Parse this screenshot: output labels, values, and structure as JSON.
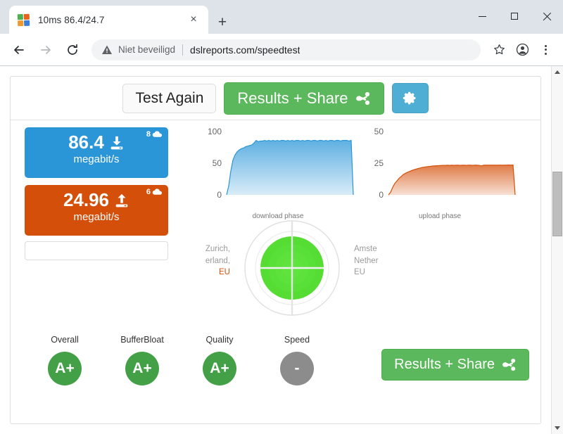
{
  "window": {
    "minimize_label": "Minimize",
    "maximize_label": "Maximize",
    "close_label": "Close"
  },
  "tab": {
    "title": "10ms 86.4/24.7",
    "close_label": "×",
    "newtab_label": "+"
  },
  "toolbar": {
    "back_label": "←",
    "forward_label": "→",
    "reload_label": "⟳",
    "security_text": "Niet beveiligd",
    "url": "dslreports.com/speedtest",
    "bookmark_label": "☆",
    "profile_label": "profile",
    "menu_label": "menu"
  },
  "page": {
    "top_buttons": {
      "test_again": "Test Again",
      "results_share": "Results + Share",
      "settings": "gear"
    },
    "download": {
      "value": "86.4",
      "unit": "megabit/s",
      "streams": "8"
    },
    "upload": {
      "value": "24.96",
      "unit": "megabit/s",
      "streams": "6"
    },
    "input_field": {
      "value": "",
      "placeholder": ""
    },
    "radar": {
      "left_label_line1": "Zurich,",
      "left_label_line2": "erland,",
      "left_label_line3": "EU",
      "right_label_line1": "Amste",
      "right_label_line2": "Nether",
      "right_label_line3": "EU"
    },
    "grades": [
      {
        "label": "Overall",
        "value": "A+",
        "color": "green"
      },
      {
        "label": "BufferBloat",
        "value": "A+",
        "color": "green"
      },
      {
        "label": "Quality",
        "value": "A+",
        "color": "green"
      },
      {
        "label": "Speed",
        "value": "-",
        "color": "gray"
      }
    ],
    "results_share_large": "Results + Share"
  },
  "colors": {
    "download_blue": "#2a96d8",
    "upload_orange": "#d4500a",
    "green_button": "#5cb85c",
    "gear_blue": "#4eaed4",
    "grade_green": "#43a047",
    "grade_gray": "#8c8c8c",
    "radar_green": "#55dd33"
  },
  "chart_data": [
    {
      "type": "area",
      "title": "",
      "xlabel": "download phase",
      "ylabel": "",
      "ylim": [
        0,
        100
      ],
      "yticks": [
        0,
        50,
        100
      ],
      "ytick_labels": [
        "0",
        "50",
        "100"
      ],
      "grid": false,
      "legend": "none",
      "series": [
        {
          "name": "download",
          "color": "#2a96d8",
          "values": [
            0,
            14,
            38,
            55,
            63,
            68,
            71,
            73,
            74,
            76,
            77,
            78,
            79,
            82,
            86,
            84,
            85,
            85,
            86,
            85,
            86,
            85,
            86,
            85,
            86,
            85,
            86,
            86,
            85,
            86,
            85,
            86,
            85,
            86,
            86,
            85,
            86,
            85,
            86,
            86,
            85,
            86,
            86,
            85,
            86,
            86,
            85,
            86,
            85,
            86,
            86,
            85,
            86,
            86,
            85,
            86,
            86,
            86,
            85,
            86,
            0
          ]
        }
      ]
    },
    {
      "type": "area",
      "title": "",
      "xlabel": "upload phase",
      "ylabel": "",
      "ylim": [
        0,
        50
      ],
      "yticks": [
        0,
        25,
        50
      ],
      "ytick_labels": [
        "0",
        "25",
        "50"
      ],
      "grid": false,
      "legend": "none",
      "series": [
        {
          "name": "upload",
          "color": "#d4500a",
          "values": [
            0,
            2,
            6,
            9,
            11,
            13,
            14.5,
            16,
            17,
            17.8,
            18.5,
            19.2,
            19.8,
            20.3,
            20.8,
            21.2,
            21.6,
            21.9,
            22.2,
            22.4,
            22.6,
            22.8,
            22.9,
            23.0,
            23.1,
            23.2,
            23.3,
            23.3,
            23.4,
            23.3,
            23.4,
            23.3,
            23.4,
            23.4,
            23.3,
            23.4,
            23.4,
            23.3,
            23.5,
            23.4,
            23.3,
            23.5,
            23.4,
            23.3,
            22.9,
            23.4,
            23.5,
            23.4,
            23.5,
            23.4,
            23.5,
            23.4,
            23.5,
            23.5,
            23.4,
            23.5,
            23.5,
            23.6,
            23.5,
            23.6,
            0
          ]
        }
      ]
    }
  ]
}
